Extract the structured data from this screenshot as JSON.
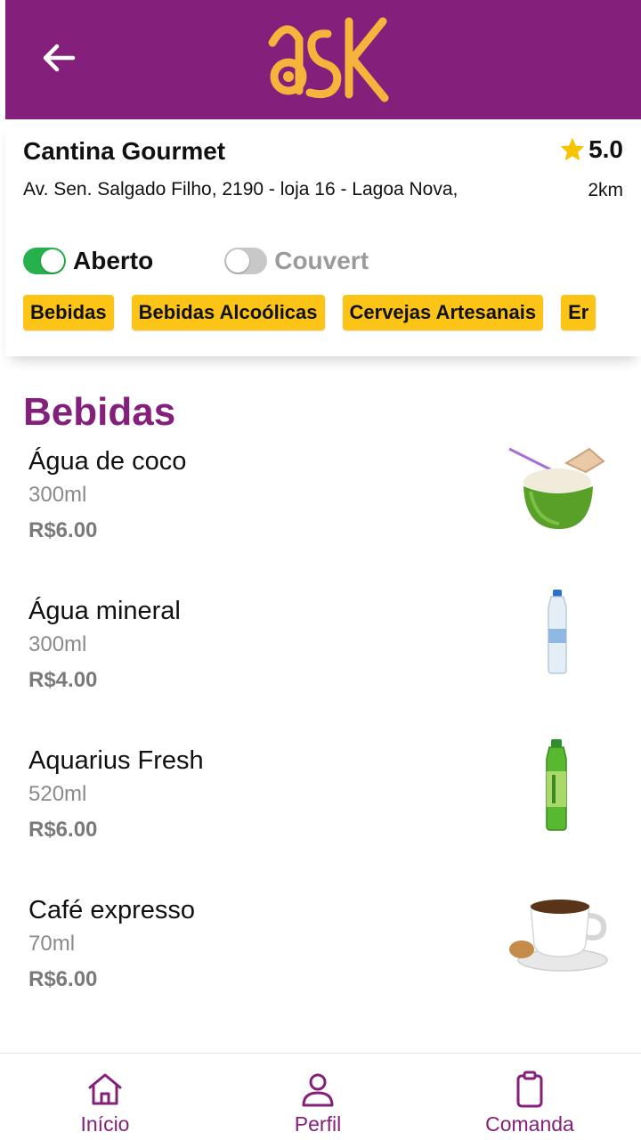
{
  "app": {
    "logo_text": "ask",
    "brand_color": "#84207c",
    "accent_color": "#fcc416"
  },
  "store": {
    "name": "Cantina Gourmet",
    "address": "Av. Sen. Salgado Filho, 2190 - loja 16 - Lagoa Nova,",
    "rating": "5.0",
    "distance": "2km",
    "open_label": "Aberto",
    "open_toggle": true,
    "couvert_label": "Couvert",
    "couvert_toggle": false
  },
  "categories": [
    "Bebidas",
    "Bebidas Alcoólicas",
    "Cervejas Artesanais",
    "Er"
  ],
  "section": {
    "title": "Bebidas"
  },
  "products": [
    {
      "name": "Água de coco",
      "volume": "300ml",
      "price": "R$6.00",
      "image": "coconut-drink"
    },
    {
      "name": "Água mineral",
      "volume": "300ml",
      "price": "R$4.00",
      "image": "water-bottle"
    },
    {
      "name": "Aquarius Fresh",
      "volume": "520ml",
      "price": "R$6.00",
      "image": "green-bottle"
    },
    {
      "name": "Café expresso",
      "volume": "70ml",
      "price": "R$6.00",
      "image": "espresso-cup"
    }
  ],
  "nav": {
    "home": "Início",
    "profile": "Perfil",
    "order": "Comanda"
  }
}
